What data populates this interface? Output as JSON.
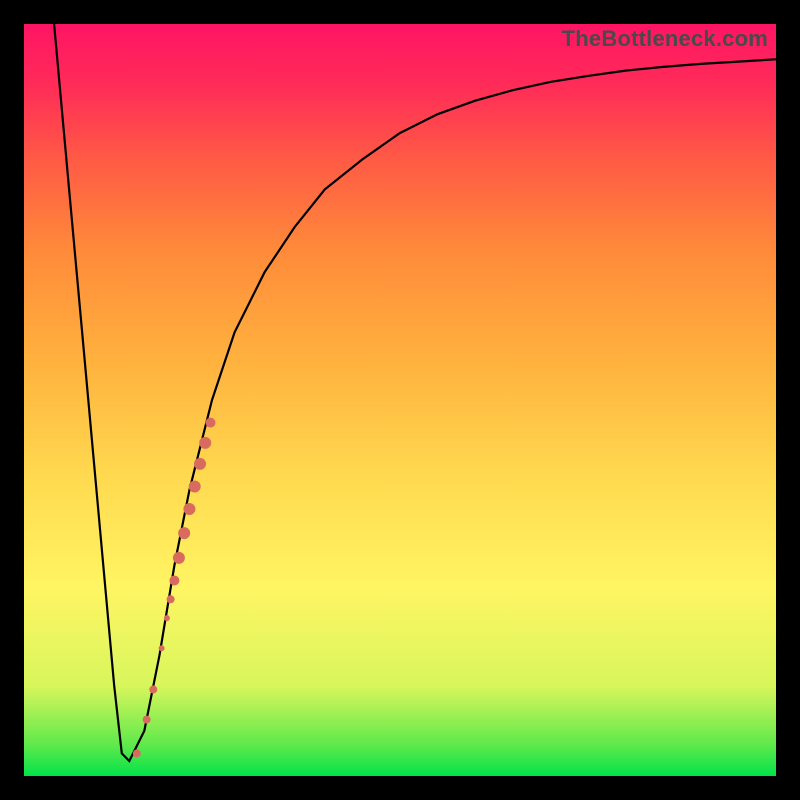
{
  "watermark": "TheBottleneck.com",
  "colors": {
    "curve": "#000000",
    "marker": "#d96b5e",
    "frame": "#000000"
  },
  "chart_data": {
    "type": "line",
    "title": "",
    "xlabel": "",
    "ylabel": "",
    "xlim": [
      0,
      100
    ],
    "ylim": [
      0,
      100
    ],
    "grid": false,
    "legend": false,
    "series": [
      {
        "name": "bottleneck-curve",
        "x": [
          4,
          6,
          8,
          10,
          12,
          13,
          14,
          16,
          18,
          20,
          22,
          25,
          28,
          32,
          36,
          40,
          45,
          50,
          55,
          60,
          65,
          70,
          75,
          80,
          85,
          90,
          95,
          100
        ],
        "y": [
          100,
          78,
          56,
          34,
          12,
          3,
          2,
          6,
          16,
          28,
          38,
          50,
          59,
          67,
          73,
          78,
          82,
          85.5,
          88,
          89.8,
          91.2,
          92.3,
          93.1,
          93.8,
          94.3,
          94.7,
          95,
          95.3
        ]
      }
    ],
    "markers": [
      {
        "x": 15.0,
        "y": 3.0,
        "r": 4
      },
      {
        "x": 16.3,
        "y": 7.5,
        "r": 4
      },
      {
        "x": 17.2,
        "y": 11.5,
        "r": 4
      },
      {
        "x": 18.3,
        "y": 17.0,
        "r": 3
      },
      {
        "x": 19.0,
        "y": 21.0,
        "r": 3
      },
      {
        "x": 19.5,
        "y": 23.5,
        "r": 4
      },
      {
        "x": 20.0,
        "y": 26.0,
        "r": 5
      },
      {
        "x": 20.6,
        "y": 29.0,
        "r": 6
      },
      {
        "x": 21.3,
        "y": 32.3,
        "r": 6
      },
      {
        "x": 22.0,
        "y": 35.5,
        "r": 6
      },
      {
        "x": 22.7,
        "y": 38.5,
        "r": 6
      },
      {
        "x": 23.4,
        "y": 41.5,
        "r": 6
      },
      {
        "x": 24.1,
        "y": 44.3,
        "r": 6
      },
      {
        "x": 24.8,
        "y": 47.0,
        "r": 5
      }
    ]
  }
}
